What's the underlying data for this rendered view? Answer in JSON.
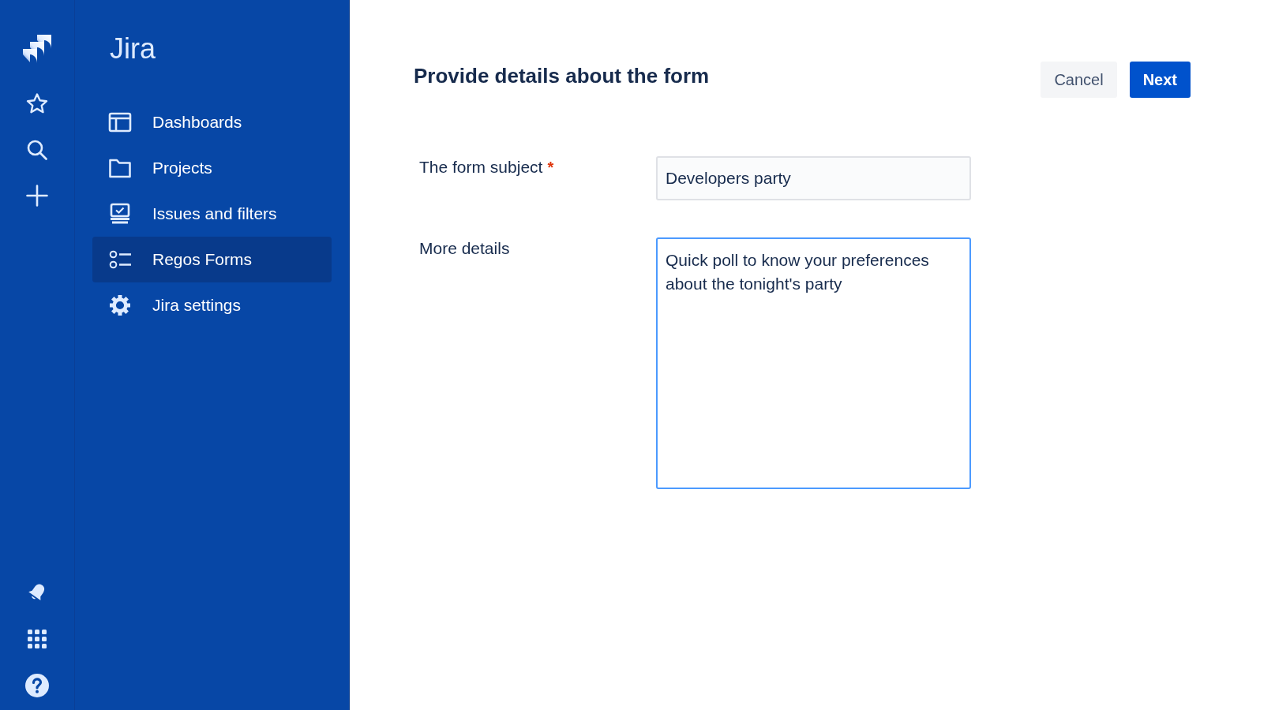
{
  "sidebar": {
    "title": "Jira",
    "items": [
      {
        "label": "Dashboards",
        "selected": false
      },
      {
        "label": "Projects",
        "selected": false
      },
      {
        "label": "Issues and filters",
        "selected": false
      },
      {
        "label": "Regos Forms",
        "selected": true
      },
      {
        "label": "Jira settings",
        "selected": false
      }
    ]
  },
  "page": {
    "title": "Provide details about the form",
    "actions": [
      {
        "label": "Cancel",
        "kind": "secondary"
      },
      {
        "label": "Next",
        "kind": "primary"
      }
    ]
  },
  "form": {
    "fields": [
      {
        "label": "The form subject",
        "required_mark": "*",
        "kind": "input",
        "value": "Developers party",
        "focused": false
      },
      {
        "label": "More details",
        "kind": "textarea",
        "value": "Quick poll to know your preferences about the tonight's party",
        "focused": true
      }
    ]
  }
}
